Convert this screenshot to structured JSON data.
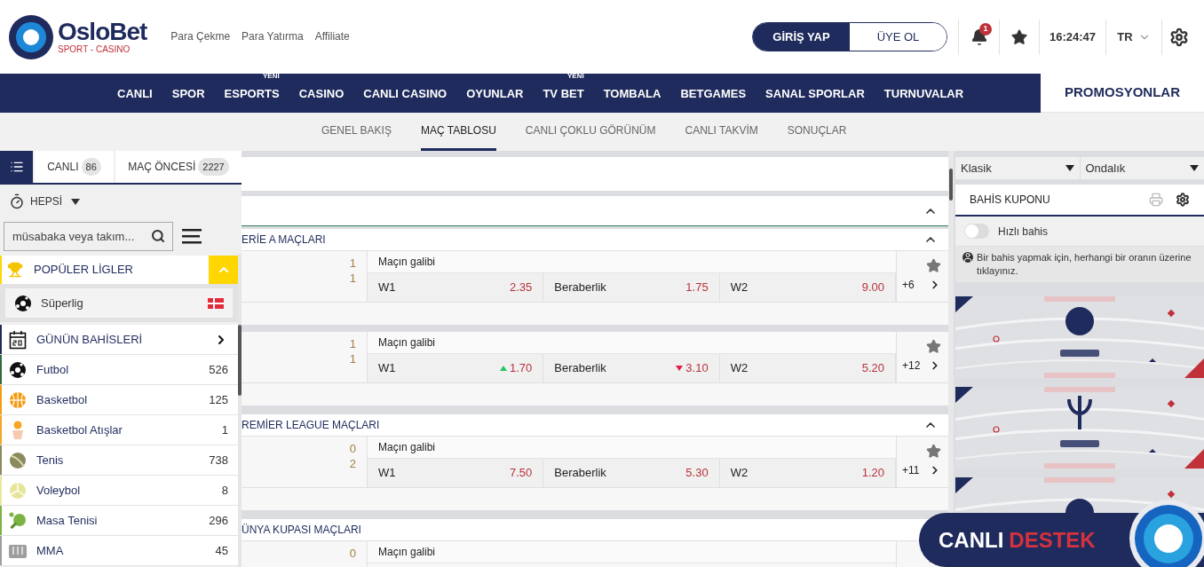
{
  "header": {
    "logo": {
      "name": "OsloBet",
      "tagline": "SPORT - CASINO"
    },
    "links": [
      "Para Çekme",
      "Para Yatırma",
      "Affiliate"
    ],
    "auth": [
      {
        "label": "GİRİŞ YAP",
        "selected": true
      },
      {
        "label": "ÜYE OL",
        "selected": false
      }
    ],
    "notifications": "1",
    "clock": "16:24:47",
    "language": "TR"
  },
  "nav": {
    "items": [
      {
        "label": "CANLI"
      },
      {
        "label": "SPOR"
      },
      {
        "label": "ESPORTS",
        "badge": "YENİ"
      },
      {
        "label": "CASINO"
      },
      {
        "label": "CANLI CASINO"
      },
      {
        "label": "OYUNLAR"
      },
      {
        "label": "TV BET",
        "badge": "YENİ"
      },
      {
        "label": "TOMBALA"
      },
      {
        "label": "BETGAMES"
      },
      {
        "label": "SANAL SPORLAR"
      },
      {
        "label": "TURNUVALAR"
      }
    ],
    "promotions": "PROMOSYONLAR"
  },
  "subnav": [
    {
      "label": "GENEL BAKIŞ",
      "selected": false
    },
    {
      "label": "MAÇ TABLOSU",
      "selected": true
    },
    {
      "label": "CANLI ÇOKLU GÖRÜNÜM",
      "selected": false
    },
    {
      "label": "CANLI TAKVİM",
      "selected": false
    },
    {
      "label": "SONUÇLAR",
      "selected": false
    }
  ],
  "sidebar": {
    "tabs": [
      {
        "kind": "icon",
        "selected": true
      },
      {
        "kind": "text",
        "label": "CANLI",
        "count": "86",
        "selected": false
      },
      {
        "kind": "text",
        "label": "MAÇ ÖNCESİ",
        "count": "2227",
        "selected": false
      }
    ],
    "filter": "HEPSİ",
    "search": {
      "placeholder": "müsabaka veya takım..."
    },
    "popular": {
      "title": "POPÜLER LİGLER",
      "expanded": true,
      "leagues": [
        {
          "name": "Süperlig"
        }
      ]
    },
    "categories": [
      {
        "kind": "calendar",
        "name": "GÜNÜN BAHİSLERİ",
        "color": "#1f2b5c"
      },
      {
        "kind": "football",
        "name": "Futbol",
        "count": "526",
        "color": "#2e6b3c"
      },
      {
        "kind": "basketball",
        "name": "Basketbol",
        "count": "125",
        "color": "#f39c12"
      },
      {
        "kind": "basket-shot",
        "name": "Basketbol Atışlar",
        "count": "1",
        "color": "#f5a623"
      },
      {
        "kind": "tennis",
        "name": "Tenis",
        "count": "738",
        "color": "#8a8a5c"
      },
      {
        "kind": "volleyball",
        "name": "Voleybol",
        "count": "8",
        "color": "#e8e8a0"
      },
      {
        "kind": "table-tennis",
        "name": "Masa Tenisi",
        "count": "296",
        "color": "#7cb342"
      },
      {
        "kind": "mma",
        "name": "MMA",
        "count": "45",
        "color": "#9e9e9e"
      }
    ]
  },
  "main": {
    "section": {
      "expanded": true
    },
    "leagues": [
      {
        "title": "ERİE A MAÇLARI",
        "expanded": true,
        "matches": [
          {
            "scores": [
              "1",
              "1"
            ],
            "market": "Maçın galibi",
            "odds": [
              {
                "label": "W1",
                "value": "2.35"
              },
              {
                "label": "Beraberlik",
                "value": "1.75"
              },
              {
                "label": "W2",
                "value": "9.00"
              }
            ],
            "more": "+6"
          },
          {
            "scores": [
              "1",
              "1"
            ],
            "market": "Maçın galibi",
            "odds": [
              {
                "label": "W1",
                "value": "1.70",
                "up": true
              },
              {
                "label": "Beraberlik",
                "value": "3.10",
                "down": true
              },
              {
                "label": "W2",
                "value": "5.20"
              }
            ],
            "more": "+12"
          }
        ]
      },
      {
        "title": "REMİER LEAGUE MAÇLARI",
        "expanded": true,
        "matches": [
          {
            "scores": [
              "0",
              "2"
            ],
            "market": "Maçın galibi",
            "odds": [
              {
                "label": "W1",
                "value": "7.50"
              },
              {
                "label": "Beraberlik",
                "value": "5.30"
              },
              {
                "label": "W2",
                "value": "1.20"
              }
            ],
            "more": "+11"
          }
        ]
      },
      {
        "title": "ÜNYA KUPASI MAÇLARI",
        "matches": [
          {
            "scores": [
              "0"
            ],
            "market": "Maçın galibi"
          }
        ]
      }
    ]
  },
  "coupon": {
    "formats": [
      "Klasik",
      "Ondalık"
    ],
    "title": "BAHİS KUPONU",
    "quick_bet": {
      "label": "Hızlı bahis",
      "on": false
    },
    "info": "Bir bahis yapmak için, herhangi bir oranın üzerine tıklayınız.",
    "banners": [
      {
        "kind": "picture"
      },
      {
        "kind": "picture"
      },
      {
        "kind": "picture"
      }
    ]
  },
  "live_support": {
    "first": "CANLI",
    "second": "DESTEK"
  }
}
